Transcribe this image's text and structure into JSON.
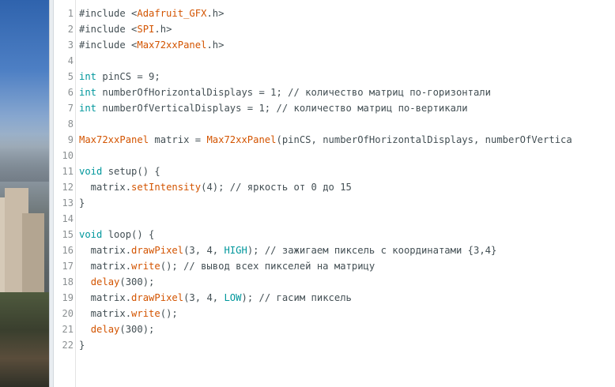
{
  "desktop_background": "photo-city-view",
  "editor": {
    "lines": [
      {
        "n": "1",
        "tokens": [
          [
            "",
            "#include <"
          ],
          [
            "cls",
            "Adafruit_GFX"
          ],
          [
            "",
            ".h>"
          ]
        ]
      },
      {
        "n": "2",
        "tokens": [
          [
            "",
            "#include <"
          ],
          [
            "cls",
            "SPI"
          ],
          [
            "",
            ".h>"
          ]
        ]
      },
      {
        "n": "3",
        "tokens": [
          [
            "",
            "#include <"
          ],
          [
            "cls",
            "Max72xxPanel"
          ],
          [
            "",
            ".h>"
          ]
        ]
      },
      {
        "n": "4",
        "tokens": []
      },
      {
        "n": "5",
        "tokens": [
          [
            "kw",
            "int"
          ],
          [
            "",
            " pinCS = 9;"
          ]
        ]
      },
      {
        "n": "6",
        "tokens": [
          [
            "kw",
            "int"
          ],
          [
            "",
            " numberOfHorizontalDisplays = 1; // количество матриц по-горизонтали"
          ]
        ]
      },
      {
        "n": "7",
        "tokens": [
          [
            "kw",
            "int"
          ],
          [
            "",
            " numberOfVerticalDisplays = 1; // количество матриц по-вертикали"
          ]
        ]
      },
      {
        "n": "8",
        "tokens": []
      },
      {
        "n": "9",
        "tokens": [
          [
            "cls",
            "Max72xxPanel"
          ],
          [
            "",
            " matrix = "
          ],
          [
            "cls",
            "Max72xxPanel"
          ],
          [
            "",
            "(pinCS, numberOfHorizontalDisplays, numberOfVertica"
          ]
        ]
      },
      {
        "n": "10",
        "tokens": []
      },
      {
        "n": "11",
        "tokens": [
          [
            "kw",
            "void"
          ],
          [
            "",
            " setup() {"
          ]
        ]
      },
      {
        "n": "12",
        "tokens": [
          [
            "",
            "  matrix."
          ],
          [
            "fn",
            "setIntensity"
          ],
          [
            "",
            "(4); // яркость от 0 до 15"
          ]
        ]
      },
      {
        "n": "13",
        "tokens": [
          [
            "",
            "}"
          ]
        ]
      },
      {
        "n": "14",
        "tokens": []
      },
      {
        "n": "15",
        "tokens": [
          [
            "kw",
            "void"
          ],
          [
            "",
            " loop() {"
          ]
        ]
      },
      {
        "n": "16",
        "tokens": [
          [
            "",
            "  matrix."
          ],
          [
            "fn",
            "drawPixel"
          ],
          [
            "",
            "(3, 4, "
          ],
          [
            "cst",
            "HIGH"
          ],
          [
            "",
            "); // зажигаем пиксель с координатами {3,4}"
          ]
        ]
      },
      {
        "n": "17",
        "tokens": [
          [
            "",
            "  matrix."
          ],
          [
            "fn",
            "write"
          ],
          [
            "",
            "(); // вывод всех пикселей на матрицу"
          ]
        ]
      },
      {
        "n": "18",
        "tokens": [
          [
            "",
            "  "
          ],
          [
            "fn",
            "delay"
          ],
          [
            "",
            "(300);"
          ]
        ]
      },
      {
        "n": "19",
        "tokens": [
          [
            "",
            "  matrix."
          ],
          [
            "fn",
            "drawPixel"
          ],
          [
            "",
            "(3, 4, "
          ],
          [
            "cst",
            "LOW"
          ],
          [
            "",
            "); // гасим пиксель"
          ]
        ]
      },
      {
        "n": "20",
        "tokens": [
          [
            "",
            "  matrix."
          ],
          [
            "fn",
            "write"
          ],
          [
            "",
            "();"
          ]
        ]
      },
      {
        "n": "21",
        "tokens": [
          [
            "",
            "  "
          ],
          [
            "fn",
            "delay"
          ],
          [
            "",
            "(300);"
          ]
        ]
      },
      {
        "n": "22",
        "tokens": [
          [
            "",
            "}"
          ]
        ]
      }
    ]
  }
}
